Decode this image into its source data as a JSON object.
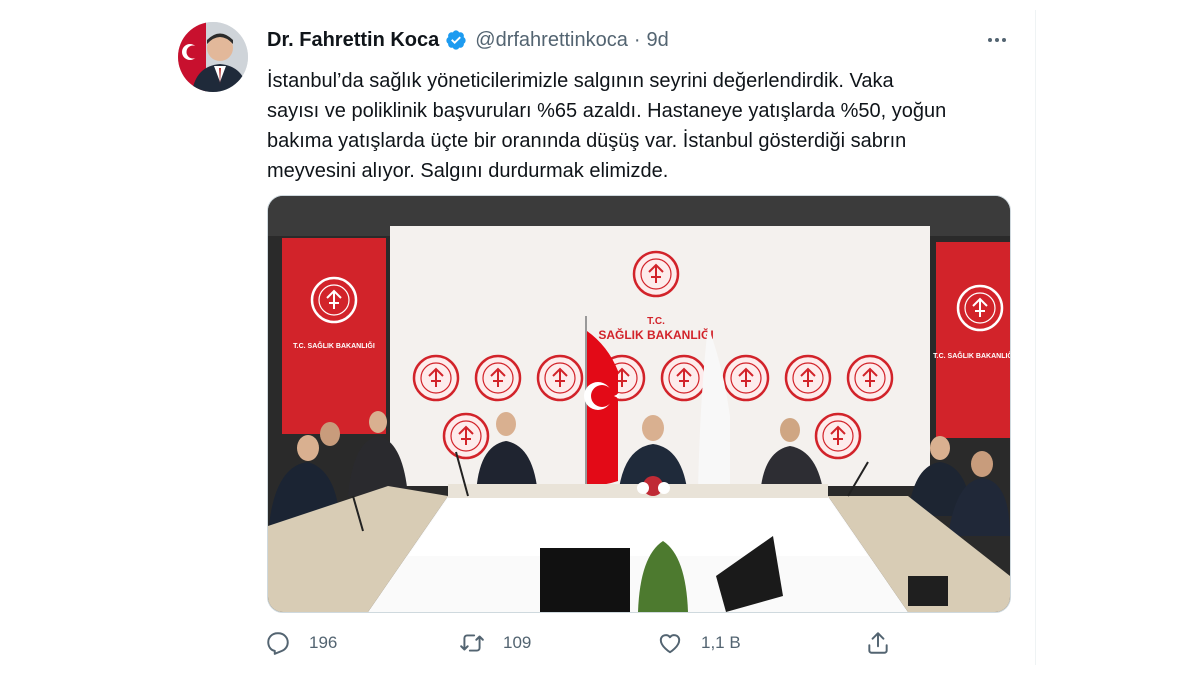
{
  "tweet": {
    "author_name": "Dr. Fahrettin Koca",
    "handle": "@drfahrettinkoca",
    "separator": "·",
    "time": "9d",
    "text": "İstanbul’da sağlık yöneticilerimizle  salgının seyrini değerlendirdik. Vaka\nsayısı ve poliklinik başvuruları %65 azaldı. Hastaneye yatışlarda %50, yoğun\nbakıma yatışlarda üçte bir oranında düşüş var. İstanbul gösterdiği sabrın\nmeyvesini alıyor. Salgını durdurmak elimizde."
  },
  "media": {
    "banner_text": "T.C. SAĞLIK BAKANLIĞI",
    "backdrop_title_line1": "T.C.",
    "backdrop_title_line2": "SAĞLIK BAKANLIĞI"
  },
  "actions": {
    "replies": "196",
    "retweets": "109",
    "likes": "1,1 B"
  },
  "icons": {
    "verified": "verified-badge-icon",
    "more": "more-horizontal-icon",
    "reply": "reply-icon",
    "retweet": "retweet-icon",
    "like": "heart-icon",
    "share": "share-icon"
  },
  "colors": {
    "brand_blue": "#1d9bf0",
    "text": "#0f1419",
    "secondary": "#536471",
    "red": "#d2232a"
  }
}
